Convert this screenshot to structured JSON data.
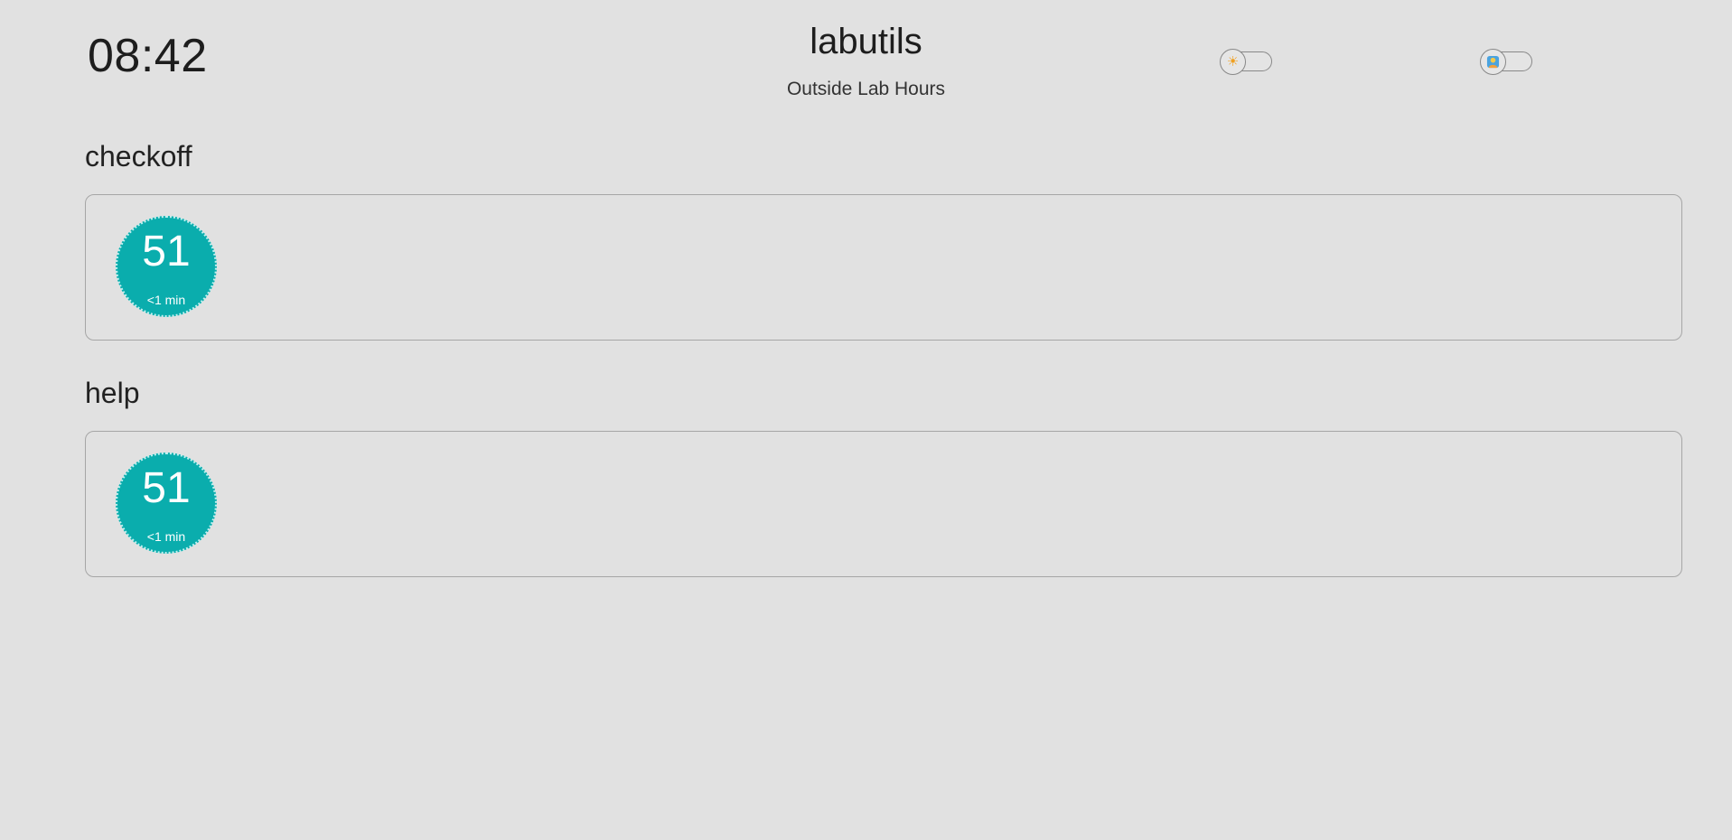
{
  "header": {
    "clock": "08:42",
    "title": "labutils",
    "subtitle": "Outside Lab Hours"
  },
  "toggles": {
    "theme": {
      "icon": "sun-icon",
      "glyph": "☀",
      "on": false
    },
    "mode": {
      "icon": "person-icon",
      "glyph": "👤",
      "on": false
    }
  },
  "queues": [
    {
      "name": "checkoff",
      "count": "51",
      "wait": "<1 min"
    },
    {
      "name": "help",
      "count": "51",
      "wait": "<1 min"
    }
  ],
  "colors": {
    "background": "#e1e1e1",
    "badge": "#0aadad",
    "sun": "#f0a020"
  }
}
